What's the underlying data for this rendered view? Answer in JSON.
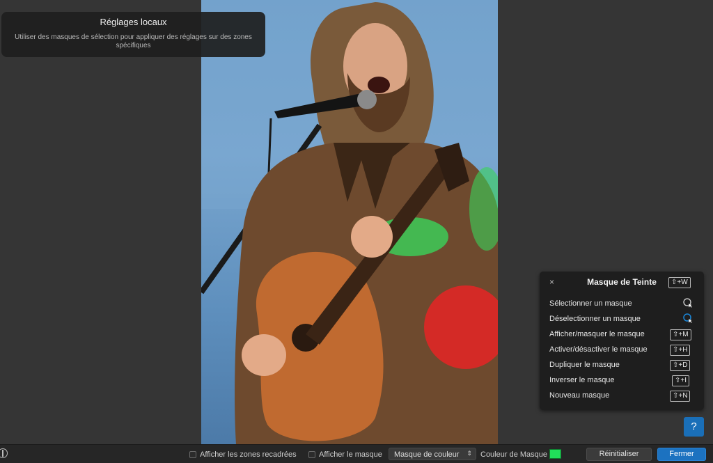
{
  "hint": {
    "title": "Réglages locaux",
    "text": "Utiliser des masques de sélection pour appliquer des réglages sur des zones spécifiques"
  },
  "panel": {
    "close": "×",
    "title": "Masque de Teinte",
    "title_shortcut": "⇧+W",
    "rows": [
      {
        "label": "Sélectionner un masque",
        "icon": "select-cursor-icon"
      },
      {
        "label": "Déselectionner un masque",
        "icon": "deselect-cursor-icon"
      },
      {
        "label": "Afficher/masquer le masque",
        "shortcut": "⇧+M"
      },
      {
        "label": "Activer/désactiver le masque",
        "shortcut": "⇧+H"
      },
      {
        "label": "Dupliquer le masque",
        "shortcut": "⇧+D"
      },
      {
        "label": "Inverser le masque",
        "shortcut": "⇧+I"
      },
      {
        "label": "Nouveau masque",
        "shortcut": "⇧+N"
      }
    ]
  },
  "help": "?",
  "toolbar": {
    "show_cropped": "Afficher les zones recadrées",
    "show_mask": "Afficher le masque",
    "mask_type": "Masque de couleur",
    "mask_color_label": "Couleur de Masque",
    "mask_color": "#21e05a",
    "reset": "Réinitialiser",
    "close": "Fermer"
  },
  "colors": {
    "accent": "#1c72c0",
    "panel_bg": "#1e1e1e",
    "background": "#353535"
  }
}
